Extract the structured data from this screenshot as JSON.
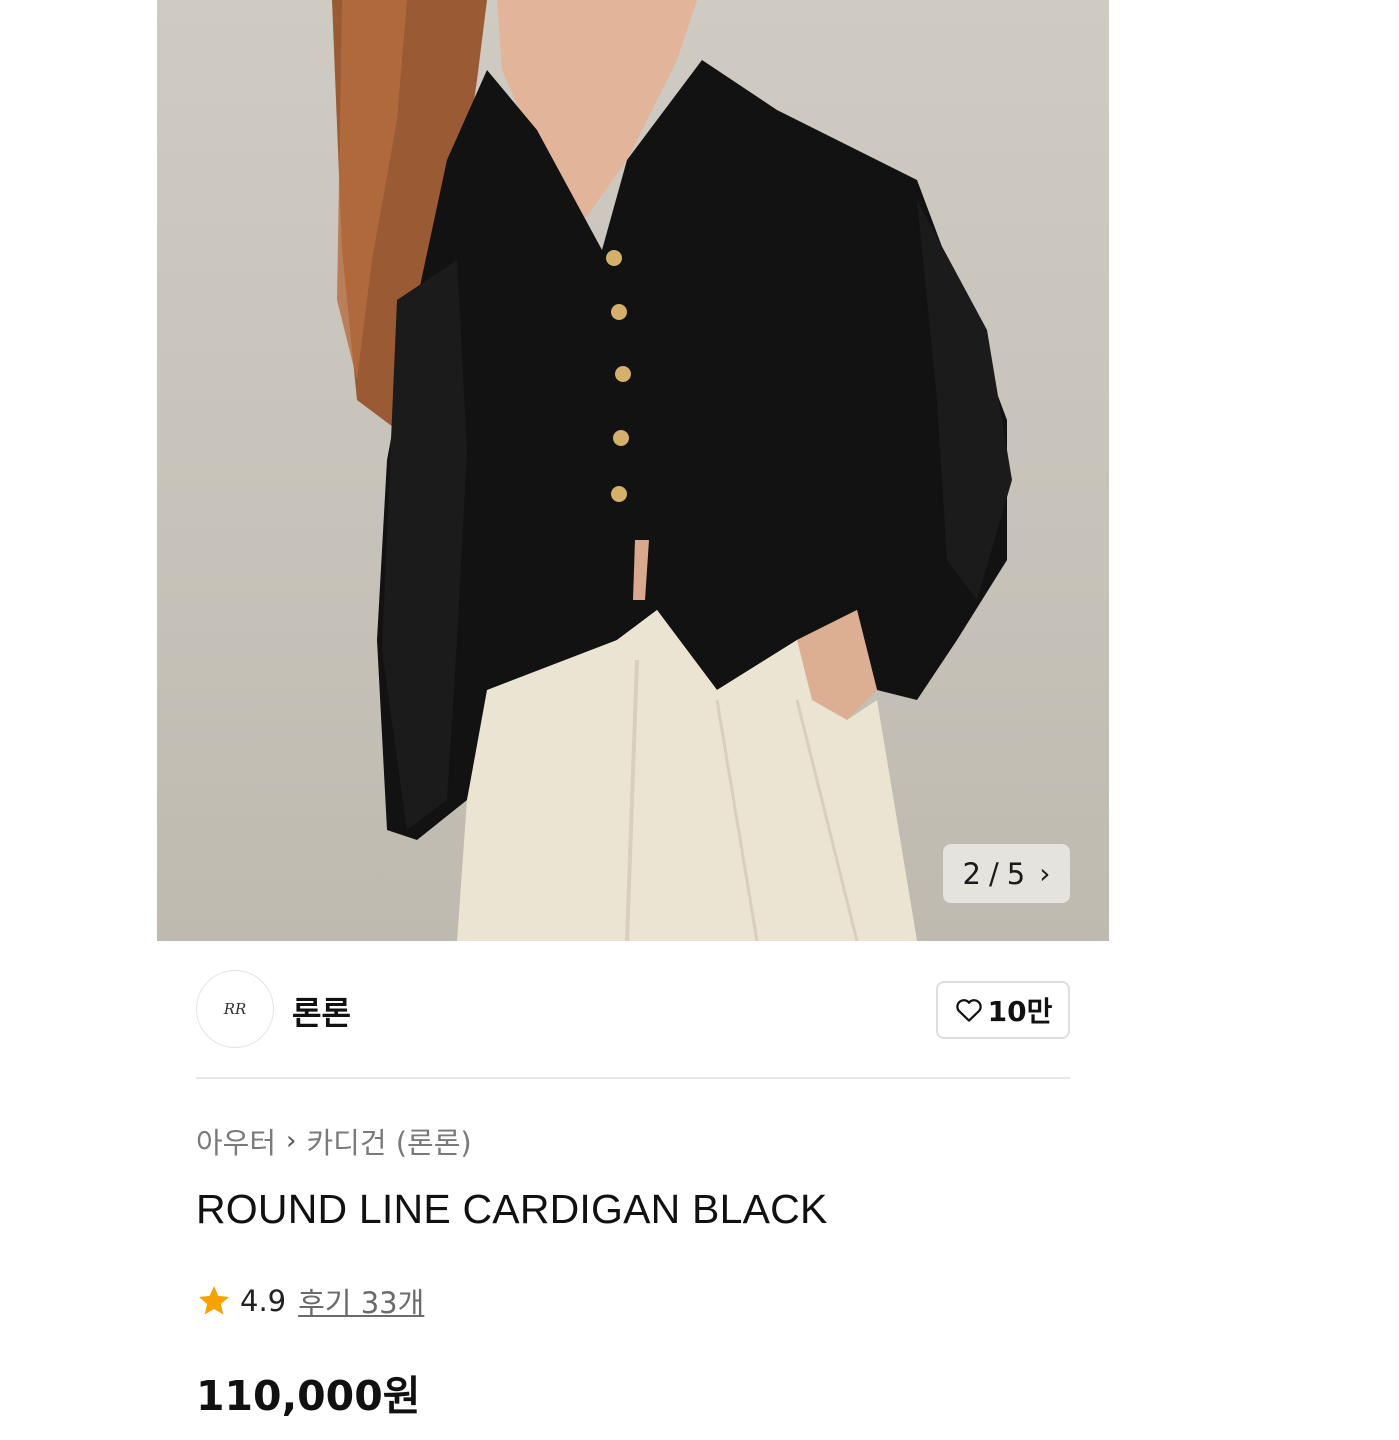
{
  "gallery": {
    "alt": "Model wearing black V-neck cardigan with gold buttons and cream pleated trousers",
    "counter_current": "2",
    "counter_separator": "/",
    "counter_total": "5"
  },
  "brand": {
    "name": "론론",
    "logo_text": "RR",
    "like_count": "10만"
  },
  "breadcrumb": {
    "items": [
      "아우터",
      "카디건 (론론)"
    ]
  },
  "product": {
    "title": "ROUND LINE CARDIGAN BLACK",
    "rating": "4.9",
    "reviews_label": "후기 33개",
    "price": "110,000원"
  },
  "colors": {
    "star": "#f5a300",
    "background": "#cfcbc3"
  }
}
